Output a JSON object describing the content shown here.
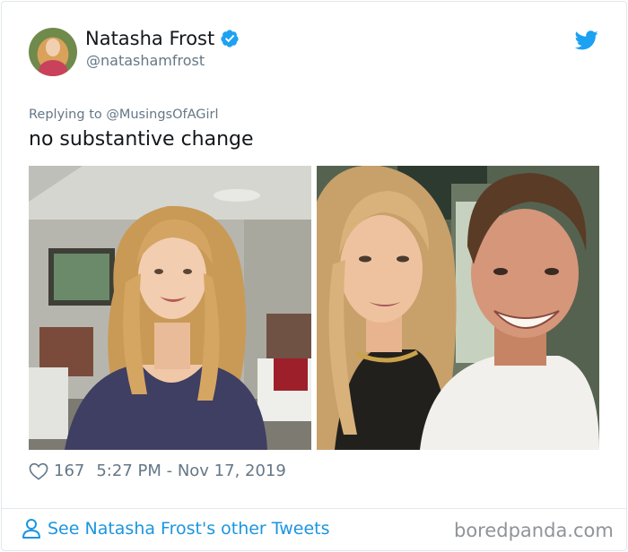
{
  "author": {
    "name": "Natasha Frost",
    "handle": "@natashamfrost",
    "verified": true
  },
  "tweet": {
    "replying_label": "Replying to ",
    "replying_to": "@MusingsOfAGirl",
    "text": "no substantive change"
  },
  "stats": {
    "likes": "167",
    "timestamp": "5:27 PM - Nov 17, 2019"
  },
  "footer": {
    "see_more": "See Natasha Frost's other Tweets",
    "watermark": "boredpanda.com"
  },
  "colors": {
    "link": "#1b95e0",
    "twitter_blue": "#1da1f2",
    "secondary_text": "#657786"
  },
  "icons": [
    "verified-badge-icon",
    "twitter-bird-icon",
    "heart-icon",
    "person-icon"
  ]
}
